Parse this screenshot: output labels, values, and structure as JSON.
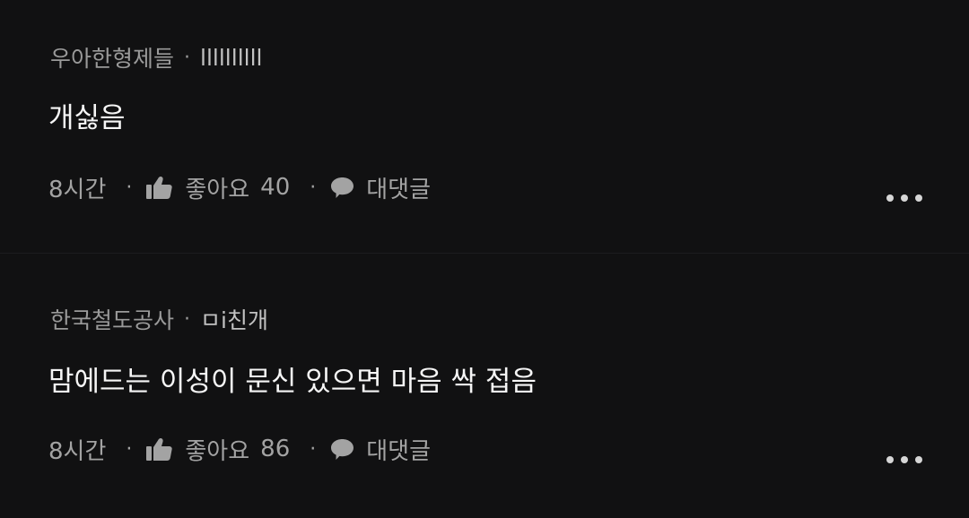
{
  "comments": [
    {
      "author": "우아한형제들",
      "separator": "·",
      "nickname": "llllllllll",
      "body": "개싫음",
      "time": "8시간",
      "like_label": "좋아요",
      "like_count": "40",
      "reply_label": "대댓글",
      "like_icon": "thumbs-up-icon",
      "reply_icon": "speech-bubble-icon",
      "more_icon": "more-dots-icon"
    },
    {
      "author": "한국철도공사",
      "separator": "·",
      "nickname": "ㅁi친개",
      "body": "맘에드는 이성이 문신 있으면 마음 싹 접음",
      "time": "8시간",
      "like_label": "좋아요",
      "like_count": "86",
      "reply_label": "대댓글",
      "like_icon": "thumbs-up-icon",
      "reply_icon": "speech-bubble-icon",
      "more_icon": "more-dots-icon"
    }
  ],
  "colors": {
    "background": "#111112",
    "primary_text": "#f6f6f6",
    "secondary_text": "#a3a3a3",
    "divider": "#1d1d1f"
  }
}
